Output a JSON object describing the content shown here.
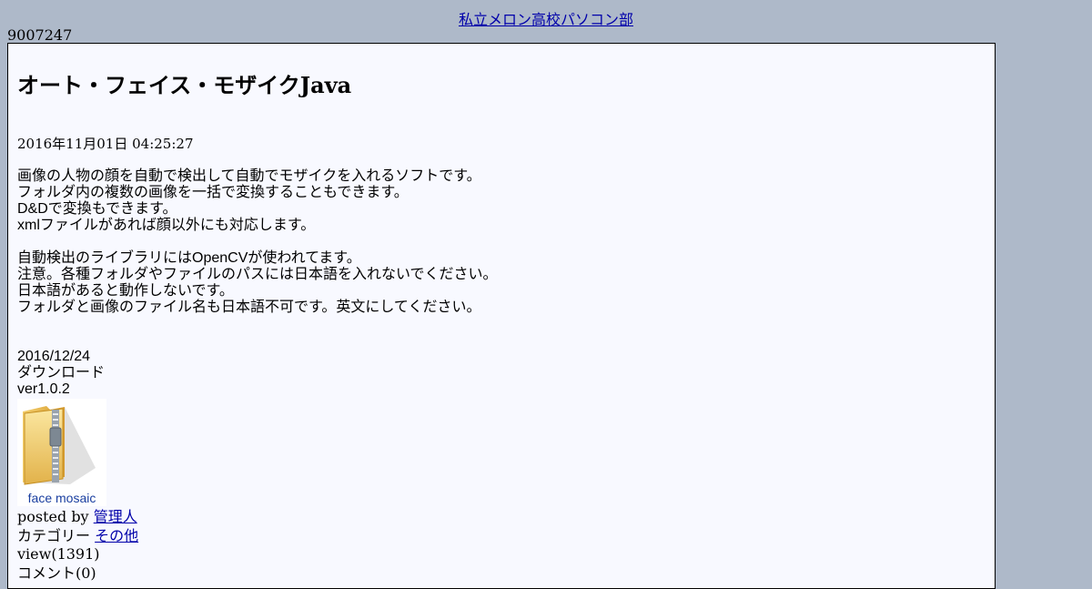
{
  "header": {
    "site_title": "私立メロン高校パソコン部"
  },
  "counter": "9007247",
  "post": {
    "title": "オート・フェイス・モザイクJava",
    "date": "2016年11月01日 04:25:27",
    "body_lines": [
      "画像の人物の顔を自動で検出して自動でモザイクを入れるソフトです。",
      "フォルダ内の複数の画像を一括で変換することもできます。",
      "D&Dで変換もできます。",
      "xmlファイルがあれば顔以外にも対応します。",
      "",
      "自動検出のライブラリにはOpenCVが使われてます。",
      "注意。各種フォルダやファイルのパスには日本語を入れないでください。",
      "日本語があると動作しないです。",
      "フォルダと画像のファイル名も日本語不可です。英文にしてください。"
    ],
    "download": {
      "date": "2016/12/24",
      "label": "ダウンロード",
      "version": "ver1.0.2",
      "file_caption": "face mosaic",
      "icon": "zip-folder-icon"
    },
    "meta": {
      "posted_by_prefix": "posted by",
      "author": "管理人",
      "category_prefix": "カテゴリー",
      "category": "その他",
      "views": "view(1391)",
      "comments": "コメント(0)"
    }
  }
}
